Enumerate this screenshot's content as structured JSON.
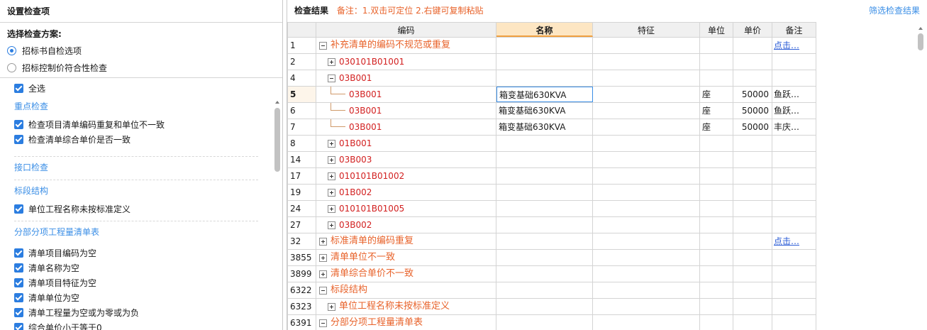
{
  "left": {
    "title": "设置检查项",
    "scheme_label": "选择检查方案:",
    "schemes": [
      {
        "label": "招标书自检选项",
        "selected": true
      },
      {
        "label": "招标控制价符合性检查",
        "selected": false
      }
    ],
    "select_all": "全选",
    "sections": [
      {
        "title": "重点检查",
        "items": [
          "检查项目清单编码重复和单位不一致",
          "检查清单综合单价是否一致"
        ]
      },
      {
        "title": "接口检查",
        "items": []
      },
      {
        "title": "标段结构",
        "items": [
          "单位工程名称未按标准定义"
        ]
      },
      {
        "title": "分部分项工程量清单表",
        "items": [
          "清单项目编码为空",
          "清单名称为空",
          "清单项目特征为空",
          "清单单位为空",
          "清单工程量为空或为零或为负",
          "综合单价小于等于0"
        ]
      }
    ]
  },
  "right": {
    "title": "检查结果",
    "note": "备注：1.双击可定位 2.右键可复制粘贴",
    "filter_link": "筛选检查结果",
    "columns": [
      "编码",
      "名称",
      "特征",
      "单位",
      "单价",
      "备注"
    ],
    "selected_column": 1,
    "rows": [
      {
        "num": "1",
        "level": 0,
        "toggle": "minus",
        "text": "补充清单的编码不规范或重复",
        "style": "orange",
        "name": "",
        "unit": "",
        "price": "",
        "remark": "点击…",
        "remark_link": true
      },
      {
        "num": "2",
        "level": 1,
        "toggle": "plus",
        "text": "030101B01001",
        "style": "red",
        "name": "",
        "unit": "",
        "price": "",
        "remark": ""
      },
      {
        "num": "4",
        "level": 1,
        "toggle": "minus",
        "text": "03B001",
        "style": "red",
        "name": "",
        "unit": "",
        "price": "",
        "remark": ""
      },
      {
        "num": "5",
        "level": 2,
        "toggle": "leaf",
        "text": "03B001",
        "style": "red",
        "name": "箱变基础630KVA",
        "unit": "座",
        "price": "50000",
        "remark": "鱼跃…",
        "current": true
      },
      {
        "num": "6",
        "level": 2,
        "toggle": "leaf",
        "text": "03B001",
        "style": "red",
        "name": "箱变基础630KVA",
        "unit": "座",
        "price": "50000",
        "remark": "鱼跃…"
      },
      {
        "num": "7",
        "level": 2,
        "toggle": "leaf",
        "text": "03B001",
        "style": "red",
        "name": "箱变基础630KVA",
        "unit": "座",
        "price": "50000",
        "remark": "丰庆…"
      },
      {
        "num": "8",
        "level": 1,
        "toggle": "plus",
        "text": "01B001",
        "style": "red",
        "name": "",
        "unit": "",
        "price": "",
        "remark": ""
      },
      {
        "num": "14",
        "level": 1,
        "toggle": "plus",
        "text": "03B003",
        "style": "red",
        "name": "",
        "unit": "",
        "price": "",
        "remark": ""
      },
      {
        "num": "17",
        "level": 1,
        "toggle": "plus",
        "text": "010101B01002",
        "style": "red",
        "name": "",
        "unit": "",
        "price": "",
        "remark": ""
      },
      {
        "num": "19",
        "level": 1,
        "toggle": "plus",
        "text": "01B002",
        "style": "red",
        "name": "",
        "unit": "",
        "price": "",
        "remark": ""
      },
      {
        "num": "24",
        "level": 1,
        "toggle": "plus",
        "text": "010101B01005",
        "style": "red",
        "name": "",
        "unit": "",
        "price": "",
        "remark": ""
      },
      {
        "num": "27",
        "level": 1,
        "toggle": "plus",
        "text": "03B002",
        "style": "red",
        "name": "",
        "unit": "",
        "price": "",
        "remark": ""
      },
      {
        "num": "32",
        "level": 0,
        "toggle": "plus",
        "text": "标准清单的编码重复",
        "style": "orange",
        "name": "",
        "unit": "",
        "price": "",
        "remark": "点击…",
        "remark_link": true
      },
      {
        "num": "3855",
        "level": 0,
        "toggle": "plus",
        "text": "清单单位不一致",
        "style": "orange",
        "name": "",
        "unit": "",
        "price": "",
        "remark": ""
      },
      {
        "num": "3899",
        "level": 0,
        "toggle": "plus",
        "text": "清单综合单价不一致",
        "style": "orange",
        "name": "",
        "unit": "",
        "price": "",
        "remark": ""
      },
      {
        "num": "6322",
        "level": 0,
        "toggle": "minus",
        "text": "标段结构",
        "style": "orange",
        "name": "",
        "unit": "",
        "price": "",
        "remark": ""
      },
      {
        "num": "6323",
        "level": 1,
        "toggle": "plus",
        "text": "单位工程名称未按标准定义",
        "style": "orange",
        "name": "",
        "unit": "",
        "price": "",
        "remark": ""
      },
      {
        "num": "6391",
        "level": 0,
        "toggle": "minus",
        "text": "分部分项工程量清单表",
        "style": "orange",
        "name": "",
        "unit": "",
        "price": "",
        "remark": ""
      }
    ]
  },
  "colors": {
    "accent": "#2b7de0",
    "note": "#e8632b",
    "code_red": "#d22020",
    "header_selected": "#fde6c3"
  }
}
